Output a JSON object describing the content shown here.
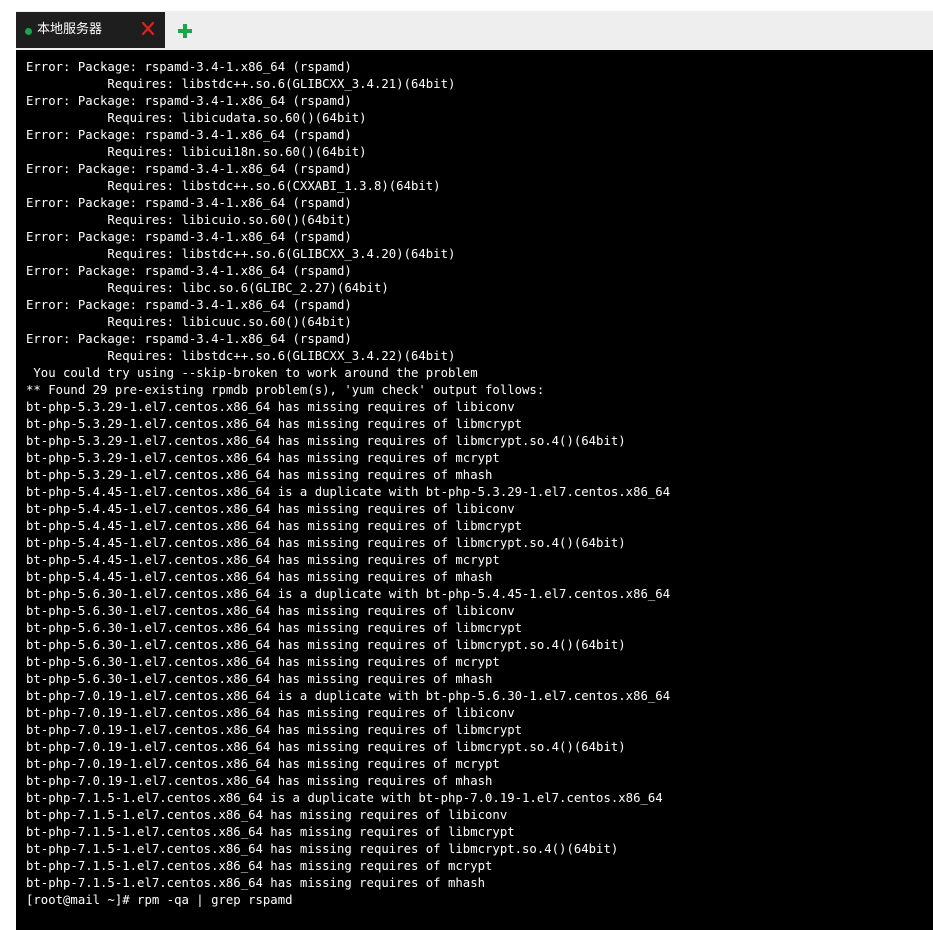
{
  "tab": {
    "title": "本地服务器",
    "status_color": "#1aa64a",
    "close_icon_color": "#e02020",
    "add_icon_color": "#1aa64a"
  },
  "terminal": {
    "background": "#000000",
    "foreground": "#ffffff",
    "lines": [
      "Error: Package: rspamd-3.4-1.x86_64 (rspamd)",
      "           Requires: libstdc++.so.6(GLIBCXX_3.4.21)(64bit)",
      "Error: Package: rspamd-3.4-1.x86_64 (rspamd)",
      "           Requires: libicudata.so.60()(64bit)",
      "Error: Package: rspamd-3.4-1.x86_64 (rspamd)",
      "           Requires: libicui18n.so.60()(64bit)",
      "Error: Package: rspamd-3.4-1.x86_64 (rspamd)",
      "           Requires: libstdc++.so.6(CXXABI_1.3.8)(64bit)",
      "Error: Package: rspamd-3.4-1.x86_64 (rspamd)",
      "           Requires: libicuio.so.60()(64bit)",
      "Error: Package: rspamd-3.4-1.x86_64 (rspamd)",
      "           Requires: libstdc++.so.6(GLIBCXX_3.4.20)(64bit)",
      "Error: Package: rspamd-3.4-1.x86_64 (rspamd)",
      "           Requires: libc.so.6(GLIBC_2.27)(64bit)",
      "Error: Package: rspamd-3.4-1.x86_64 (rspamd)",
      "           Requires: libicuuc.so.60()(64bit)",
      "Error: Package: rspamd-3.4-1.x86_64 (rspamd)",
      "           Requires: libstdc++.so.6(GLIBCXX_3.4.22)(64bit)",
      " You could try using --skip-broken to work around the problem",
      "** Found 29 pre-existing rpmdb problem(s), 'yum check' output follows:",
      "bt-php-5.3.29-1.el7.centos.x86_64 has missing requires of libiconv",
      "bt-php-5.3.29-1.el7.centos.x86_64 has missing requires of libmcrypt",
      "bt-php-5.3.29-1.el7.centos.x86_64 has missing requires of libmcrypt.so.4()(64bit)",
      "bt-php-5.3.29-1.el7.centos.x86_64 has missing requires of mcrypt",
      "bt-php-5.3.29-1.el7.centos.x86_64 has missing requires of mhash",
      "bt-php-5.4.45-1.el7.centos.x86_64 is a duplicate with bt-php-5.3.29-1.el7.centos.x86_64",
      "bt-php-5.4.45-1.el7.centos.x86_64 has missing requires of libiconv",
      "bt-php-5.4.45-1.el7.centos.x86_64 has missing requires of libmcrypt",
      "bt-php-5.4.45-1.el7.centos.x86_64 has missing requires of libmcrypt.so.4()(64bit)",
      "bt-php-5.4.45-1.el7.centos.x86_64 has missing requires of mcrypt",
      "bt-php-5.4.45-1.el7.centos.x86_64 has missing requires of mhash",
      "bt-php-5.6.30-1.el7.centos.x86_64 is a duplicate with bt-php-5.4.45-1.el7.centos.x86_64",
      "bt-php-5.6.30-1.el7.centos.x86_64 has missing requires of libiconv",
      "bt-php-5.6.30-1.el7.centos.x86_64 has missing requires of libmcrypt",
      "bt-php-5.6.30-1.el7.centos.x86_64 has missing requires of libmcrypt.so.4()(64bit)",
      "bt-php-5.6.30-1.el7.centos.x86_64 has missing requires of mcrypt",
      "bt-php-5.6.30-1.el7.centos.x86_64 has missing requires of mhash",
      "bt-php-7.0.19-1.el7.centos.x86_64 is a duplicate with bt-php-5.6.30-1.el7.centos.x86_64",
      "bt-php-7.0.19-1.el7.centos.x86_64 has missing requires of libiconv",
      "bt-php-7.0.19-1.el7.centos.x86_64 has missing requires of libmcrypt",
      "bt-php-7.0.19-1.el7.centos.x86_64 has missing requires of libmcrypt.so.4()(64bit)",
      "bt-php-7.0.19-1.el7.centos.x86_64 has missing requires of mcrypt",
      "bt-php-7.0.19-1.el7.centos.x86_64 has missing requires of mhash",
      "bt-php-7.1.5-1.el7.centos.x86_64 is a duplicate with bt-php-7.0.19-1.el7.centos.x86_64",
      "bt-php-7.1.5-1.el7.centos.x86_64 has missing requires of libiconv",
      "bt-php-7.1.5-1.el7.centos.x86_64 has missing requires of libmcrypt",
      "bt-php-7.1.5-1.el7.centos.x86_64 has missing requires of libmcrypt.so.4()(64bit)",
      "bt-php-7.1.5-1.el7.centos.x86_64 has missing requires of mcrypt",
      "bt-php-7.1.5-1.el7.centos.x86_64 has missing requires of mhash"
    ],
    "prompt": "[root@mail ~]# rpm -qa | grep rspamd"
  }
}
